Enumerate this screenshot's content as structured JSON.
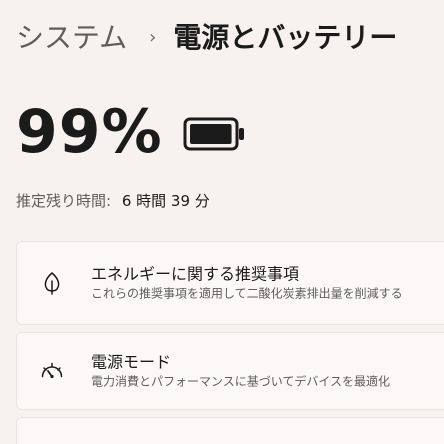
{
  "header": {
    "parent": "システム",
    "separator": "›",
    "current": "電源とバッテリー"
  },
  "battery": {
    "percent_text": "99%",
    "level": 0.99,
    "icon": "battery-full-icon",
    "remaining_label": "推定残り時間:",
    "remaining_value": "6 時間 39 分"
  },
  "cards": [
    {
      "icon": "leaf-icon",
      "title": "エネルギーに関する推奨事項",
      "description": "これらの推奨事項を適用して二酸化炭素排出量を削減する"
    },
    {
      "icon": "gauge-icon",
      "title": "電源モード",
      "description": "電力消費とパフォーマンスに基づいてデバイスを最適化"
    }
  ],
  "colors": {
    "background": "#f7f1ef",
    "card": "#fbf8f7",
    "text": "#1b1b1b",
    "secondary_text": "#5f5d5c"
  }
}
